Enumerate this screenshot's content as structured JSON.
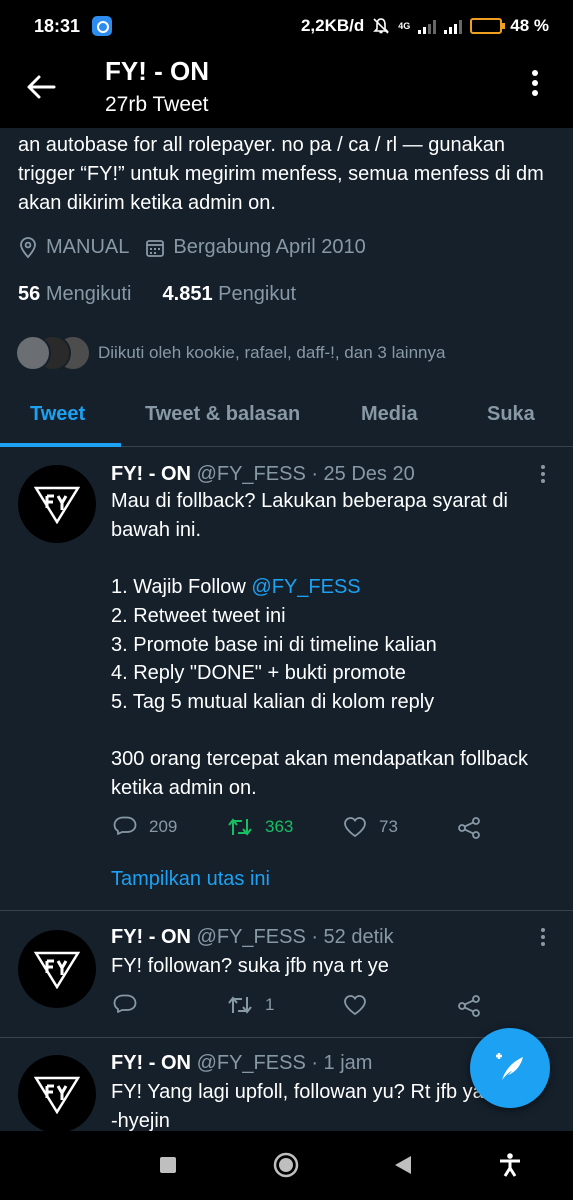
{
  "status_bar": {
    "time": "18:31",
    "speed": "2,2KB/d",
    "network": "4G",
    "battery": "48 %",
    "battery_level": 0.48
  },
  "header": {
    "title": "FY! - ON",
    "subtitle": "27rb Tweet"
  },
  "profile": {
    "bio": "an autobase for all rolepayer. no pa / ca / rl — gunakan trigger “FY!” untuk megirim menfess, semua menfess di dm akan dikirim ketika admin on.",
    "location": "MANUAL",
    "joined": "Bergabung April 2010",
    "following_count": "56",
    "following_label": "Mengikuti",
    "followers_count": "4.851",
    "followers_label": "Pengikut",
    "followed_by": "Diikuti oleh kookie, rafael, daff-!, dan 3 lainnya"
  },
  "tabs": [
    {
      "label": "Tweet",
      "active": true
    },
    {
      "label": "Tweet & balasan",
      "active": false
    },
    {
      "label": "Media",
      "active": false
    },
    {
      "label": "Suka",
      "active": false
    }
  ],
  "tweets": [
    {
      "name": "FY! - ON",
      "meta": "@FY_FESS · 25 Des 20",
      "body_intro": "Mau di follback? Lakukan beberapa syarat di bawah ini.\n\n1. Wajib Follow ",
      "mention": "@FY_FESS",
      "body_rest": "\n2. Retweet tweet ini\n3. Promote base ini di timeline kalian\n4. Reply \"DONE\" + bukti promote\n5. Tag 5 mutual kalian di kolom reply\n\n300 orang tercepat akan mendapatkan follback ketika admin on.",
      "replies": "209",
      "retweets": "363",
      "likes": "73",
      "show_thread": "Tampilkan utas ini"
    },
    {
      "name": "FY! - ON",
      "meta": "@FY_FESS · 52 detik",
      "body": "FY! followan? suka jfb nya rt ye",
      "replies": "",
      "retweets": "1",
      "likes": ""
    },
    {
      "name": "FY! - ON",
      "meta": "@FY_FESS · 1 jam",
      "body": "FY! Yang lagi upfoll, followan yu? Rt jfb ya\n-hyejin"
    }
  ],
  "colors": {
    "background": "#15202b",
    "accent": "#1da1f2",
    "retweet_active": "#17bf63",
    "secondary_text": "#8899a6",
    "divider": "#38444d"
  },
  "icons": [
    "back-arrow-icon",
    "more-vertical-icon",
    "location-icon",
    "calendar-icon",
    "reply-icon",
    "retweet-icon",
    "like-icon",
    "share-icon",
    "compose-icon"
  ]
}
